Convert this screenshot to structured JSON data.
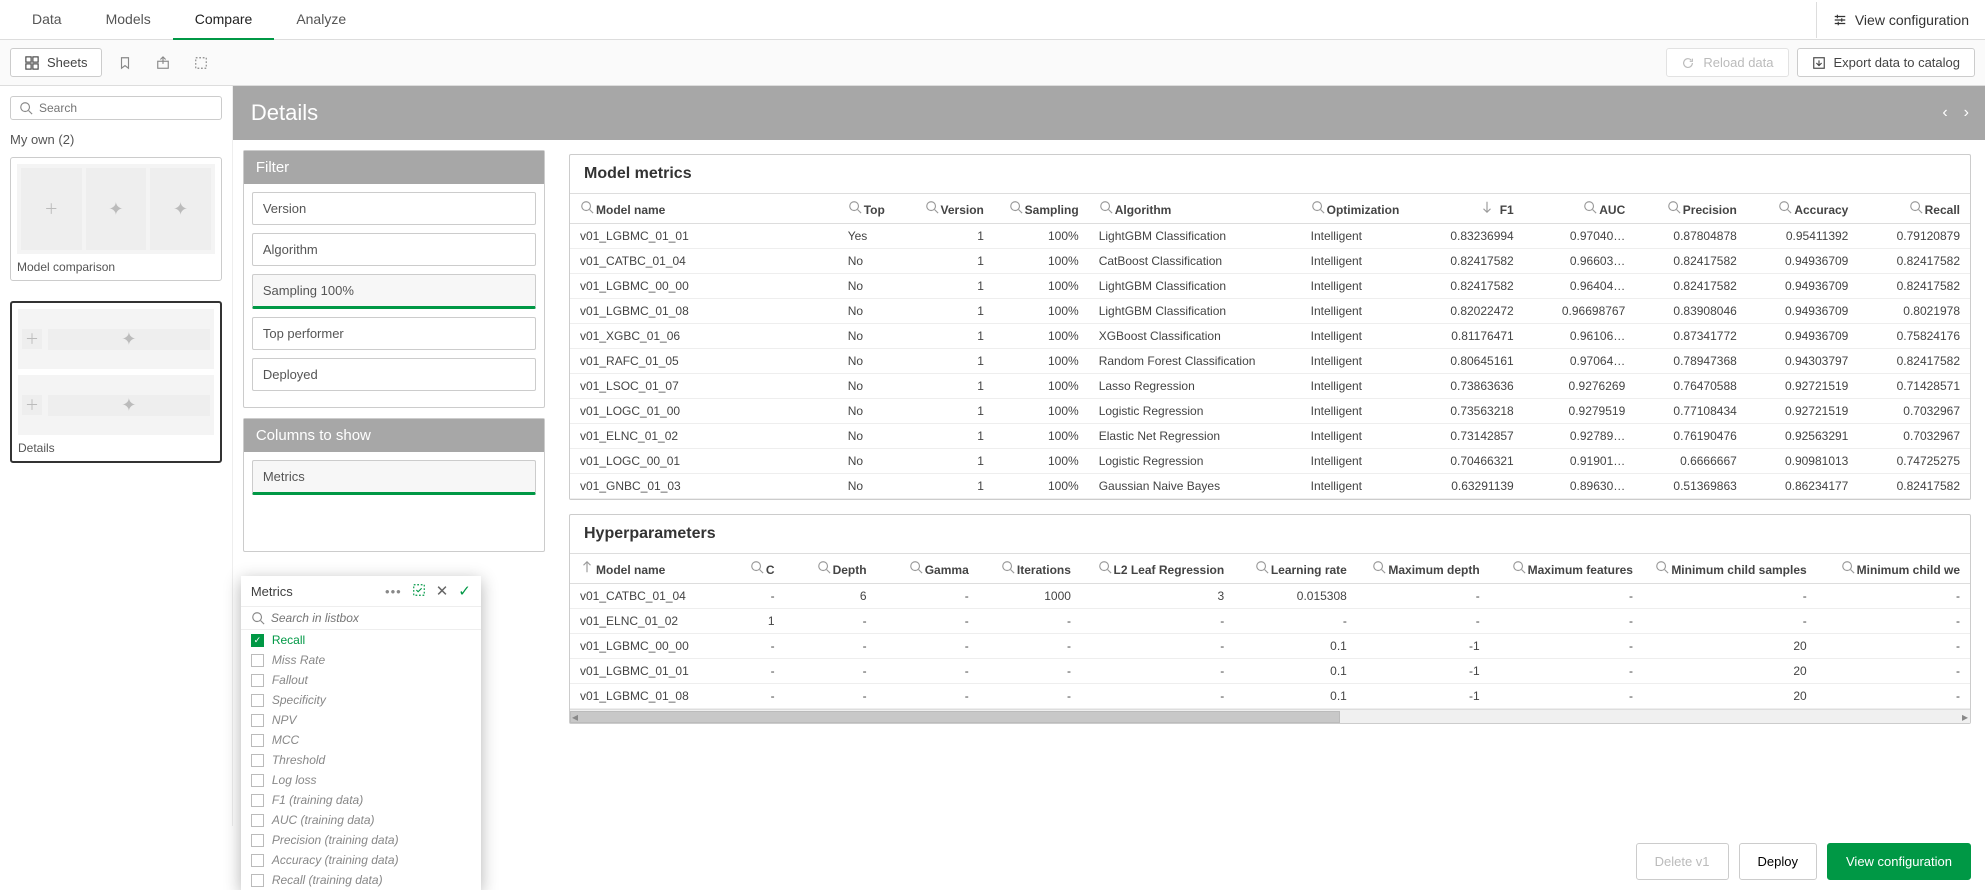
{
  "tabs": {
    "data": "Data",
    "models": "Models",
    "compare": "Compare",
    "analyze": "Analyze"
  },
  "top_actions": {
    "view_config": "View configuration"
  },
  "toolbar": {
    "sheets": "Sheets",
    "reload": "Reload data",
    "export": "Export data to catalog"
  },
  "search": {
    "placeholder": "Search"
  },
  "myown": {
    "label": "My own (2)"
  },
  "cards": {
    "model_comparison": "Model comparison",
    "details": "Details"
  },
  "details": {
    "title": "Details"
  },
  "filter": {
    "title": "Filter",
    "version": "Version",
    "algorithm": "Algorithm",
    "sampling": "Sampling 100%",
    "top_performer": "Top performer",
    "deployed": "Deployed"
  },
  "columns": {
    "title": "Columns to show",
    "metrics": "Metrics"
  },
  "popup": {
    "title": "Metrics",
    "search_placeholder": "Search in listbox",
    "items": [
      {
        "label": "Recall",
        "checked": true
      },
      {
        "label": "Miss Rate",
        "checked": false
      },
      {
        "label": "Fallout",
        "checked": false
      },
      {
        "label": "Specificity",
        "checked": false
      },
      {
        "label": "NPV",
        "checked": false
      },
      {
        "label": "MCC",
        "checked": false
      },
      {
        "label": "Threshold",
        "checked": false
      },
      {
        "label": "Log loss",
        "checked": false
      },
      {
        "label": "F1 (training data)",
        "checked": false
      },
      {
        "label": "AUC (training data)",
        "checked": false
      },
      {
        "label": "Precision (training data)",
        "checked": false
      },
      {
        "label": "Accuracy (training data)",
        "checked": false
      },
      {
        "label": "Recall (training data)",
        "checked": false
      }
    ]
  },
  "metrics": {
    "title": "Model metrics",
    "cols": [
      "Model name",
      "Top",
      "Version",
      "Sampling",
      "Algorithm",
      "Optimization",
      "F1",
      "AUC",
      "Precision",
      "Accuracy",
      "Recall"
    ],
    "rows": [
      {
        "name": "v01_LGBMC_01_01",
        "top": "Yes",
        "ver": "1",
        "samp": "100%",
        "alg": "LightGBM Classification",
        "opt": "Intelligent",
        "f1": "0.83236994",
        "auc": "0.97040…",
        "prec": "0.87804878",
        "acc": "0.95411392",
        "rec": "0.79120879"
      },
      {
        "name": "v01_CATBC_01_04",
        "top": "No",
        "ver": "1",
        "samp": "100%",
        "alg": "CatBoost Classification",
        "opt": "Intelligent",
        "f1": "0.82417582",
        "auc": "0.96603…",
        "prec": "0.82417582",
        "acc": "0.94936709",
        "rec": "0.82417582"
      },
      {
        "name": "v01_LGBMC_00_00",
        "top": "No",
        "ver": "1",
        "samp": "100%",
        "alg": "LightGBM Classification",
        "opt": "Intelligent",
        "f1": "0.82417582",
        "auc": "0.96404…",
        "prec": "0.82417582",
        "acc": "0.94936709",
        "rec": "0.82417582"
      },
      {
        "name": "v01_LGBMC_01_08",
        "top": "No",
        "ver": "1",
        "samp": "100%",
        "alg": "LightGBM Classification",
        "opt": "Intelligent",
        "f1": "0.82022472",
        "auc": "0.96698767",
        "prec": "0.83908046",
        "acc": "0.94936709",
        "rec": "0.8021978"
      },
      {
        "name": "v01_XGBC_01_06",
        "top": "No",
        "ver": "1",
        "samp": "100%",
        "alg": "XGBoost Classification",
        "opt": "Intelligent",
        "f1": "0.81176471",
        "auc": "0.96106…",
        "prec": "0.87341772",
        "acc": "0.94936709",
        "rec": "0.75824176"
      },
      {
        "name": "v01_RAFC_01_05",
        "top": "No",
        "ver": "1",
        "samp": "100%",
        "alg": "Random Forest Classification",
        "opt": "Intelligent",
        "f1": "0.80645161",
        "auc": "0.97064…",
        "prec": "0.78947368",
        "acc": "0.94303797",
        "rec": "0.82417582"
      },
      {
        "name": "v01_LSOC_01_07",
        "top": "No",
        "ver": "1",
        "samp": "100%",
        "alg": "Lasso Regression",
        "opt": "Intelligent",
        "f1": "0.73863636",
        "auc": "0.9276269",
        "prec": "0.76470588",
        "acc": "0.92721519",
        "rec": "0.71428571"
      },
      {
        "name": "v01_LOGC_01_00",
        "top": "No",
        "ver": "1",
        "samp": "100%",
        "alg": "Logistic Regression",
        "opt": "Intelligent",
        "f1": "0.73563218",
        "auc": "0.9279519",
        "prec": "0.77108434",
        "acc": "0.92721519",
        "rec": "0.7032967"
      },
      {
        "name": "v01_ELNC_01_02",
        "top": "No",
        "ver": "1",
        "samp": "100%",
        "alg": "Elastic Net Regression",
        "opt": "Intelligent",
        "f1": "0.73142857",
        "auc": "0.92789…",
        "prec": "0.76190476",
        "acc": "0.92563291",
        "rec": "0.7032967"
      },
      {
        "name": "v01_LOGC_00_01",
        "top": "No",
        "ver": "1",
        "samp": "100%",
        "alg": "Logistic Regression",
        "opt": "Intelligent",
        "f1": "0.70466321",
        "auc": "0.91901…",
        "prec": "0.6666667",
        "acc": "0.90981013",
        "rec": "0.74725275"
      },
      {
        "name": "v01_GNBC_01_03",
        "top": "No",
        "ver": "1",
        "samp": "100%",
        "alg": "Gaussian Naive Bayes",
        "opt": "Intelligent",
        "f1": "0.63291139",
        "auc": "0.89630…",
        "prec": "0.51369863",
        "acc": "0.86234177",
        "rec": "0.82417582"
      }
    ]
  },
  "hyper": {
    "title": "Hyperparameters",
    "cols": [
      "Model name",
      "C",
      "Depth",
      "Gamma",
      "Iterations",
      "L2 Leaf Regression",
      "Learning rate",
      "Maximum depth",
      "Maximum features",
      "Minimum child samples",
      "Minimum child we"
    ],
    "rows": [
      {
        "name": "v01_CATBC_01_04",
        "c": "-",
        "depth": "6",
        "gamma": "-",
        "iter": "1000",
        "l2": "3",
        "lr": "0.015308",
        "maxd": "-",
        "maxf": "-",
        "mcs": "-",
        "mcw": "-"
      },
      {
        "name": "v01_ELNC_01_02",
        "c": "1",
        "depth": "-",
        "gamma": "-",
        "iter": "-",
        "l2": "-",
        "lr": "-",
        "maxd": "-",
        "maxf": "-",
        "mcs": "-",
        "mcw": "-"
      },
      {
        "name": "v01_LGBMC_00_00",
        "c": "-",
        "depth": "-",
        "gamma": "-",
        "iter": "-",
        "l2": "-",
        "lr": "0.1",
        "maxd": "-1",
        "maxf": "-",
        "mcs": "20",
        "mcw": "-"
      },
      {
        "name": "v01_LGBMC_01_01",
        "c": "-",
        "depth": "-",
        "gamma": "-",
        "iter": "-",
        "l2": "-",
        "lr": "0.1",
        "maxd": "-1",
        "maxf": "-",
        "mcs": "20",
        "mcw": "-"
      },
      {
        "name": "v01_LGBMC_01_08",
        "c": "-",
        "depth": "-",
        "gamma": "-",
        "iter": "-",
        "l2": "-",
        "lr": "0.1",
        "maxd": "-1",
        "maxf": "-",
        "mcs": "20",
        "mcw": "-"
      }
    ]
  },
  "actions": {
    "delete": "Delete v1",
    "deploy": "Deploy",
    "viewconf": "View configuration"
  }
}
